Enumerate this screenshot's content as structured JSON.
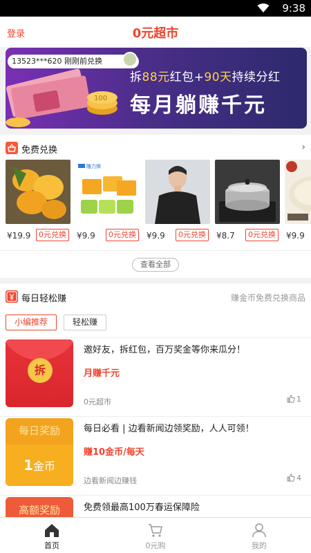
{
  "status_bar": {
    "time": "9:38"
  },
  "header": {
    "login_label": "登录",
    "title": "0元超市"
  },
  "banner": {
    "ticker": "13523***620 刚刚前兑换",
    "line1_prefix": "拆",
    "line1_hl1": "88元",
    "line1_mid": "红包+",
    "line1_hl2": "90天",
    "line1_suffix": "持续分红",
    "line2": "每月躺赚千元",
    "money_label": "100"
  },
  "free_exchange": {
    "title": "免费兑换",
    "view_all": "查看全部",
    "products": [
      {
        "price": "¥19.9",
        "action": "0元兑换",
        "icon": "mango-image"
      },
      {
        "price": "¥9.9",
        "action": "0元兑换",
        "icon": "soap-image",
        "brand": "雕力牌"
      },
      {
        "price": "¥9.9",
        "action": "0元兑换",
        "icon": "tshirt-image"
      },
      {
        "price": "¥8.7",
        "action": "0元兑换",
        "icon": "pot-image"
      },
      {
        "price": "¥9.9",
        "action": "",
        "icon": "food-image"
      }
    ]
  },
  "daily_earn": {
    "title": "每日轻松赚",
    "subtitle": "赚金币免费兑换商品",
    "chips": [
      "小编推荐",
      "轻松赚"
    ],
    "cards": [
      {
        "title": "邀好友，拆红包，百万奖金等你来瓜分！",
        "reward": "月赚千元",
        "source": "0元超市",
        "likes": "1",
        "thumb_text": "拆"
      },
      {
        "title": "每日必看 | 边看新闻边领奖励，人人可领！",
        "reward": "赚10金币/每天",
        "source": "边看新闻边赚钱",
        "likes": "4",
        "thumb_top": "每日奖励",
        "thumb_amount": "1",
        "thumb_unit": "金币"
      },
      {
        "title": "免费领最高100万春运保障险",
        "thumb_top": "高额奖励"
      }
    ]
  },
  "tab_bar": {
    "tabs": [
      {
        "label": "首页",
        "icon": "home-icon",
        "active": true
      },
      {
        "label": "0元购",
        "icon": "cart-icon",
        "active": false
      },
      {
        "label": "我的",
        "icon": "person-icon",
        "active": false
      }
    ]
  },
  "colors": {
    "accent": "#f0442e",
    "banner": "#4b2e8a",
    "gold": "#f3a31e"
  }
}
